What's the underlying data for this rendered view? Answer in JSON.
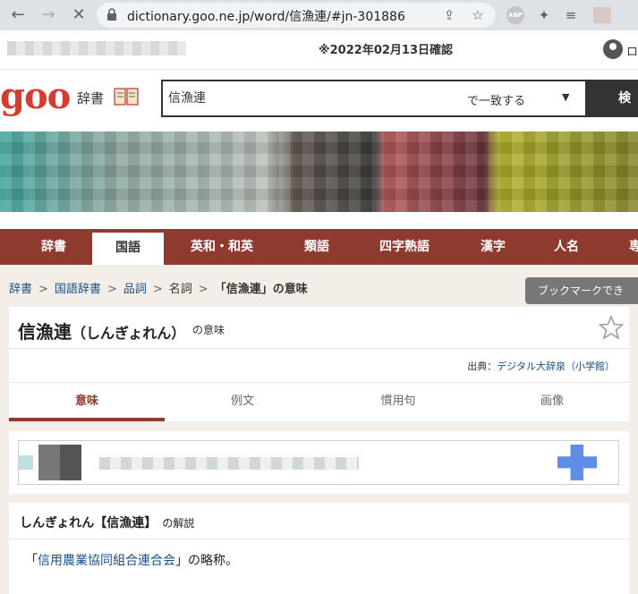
{
  "browser": {
    "url": "dictionary.goo.ne.jp/word/信漁連/#jn-301886"
  },
  "infobar": {
    "checked_date": "※2022年02月13日確認",
    "login_text": "ロ"
  },
  "header": {
    "logo": "goo",
    "dict_label": "辞書",
    "search_value": "信漁連",
    "match_mode": "で一致する",
    "search_button": "検索"
  },
  "nav": {
    "items": [
      {
        "label": "辞書",
        "active": false
      },
      {
        "label": "国語",
        "active": true
      },
      {
        "label": "英和・和英",
        "active": false
      },
      {
        "label": "類語",
        "active": false
      },
      {
        "label": "四字熟語",
        "active": false
      },
      {
        "label": "漢字",
        "active": false
      },
      {
        "label": "人名",
        "active": false
      },
      {
        "label": "専",
        "active": false
      }
    ]
  },
  "breadcrumb": {
    "items": [
      "辞書",
      "国語辞書",
      "品詞",
      "名詞"
    ],
    "current": "「信漁連」の意味"
  },
  "tooltip": "ブックマークでき",
  "entry": {
    "headword": "信漁連",
    "reading": "（しんぎょれん）",
    "suffix": "の意味",
    "source_label": "出典：",
    "source_name": "デジタル大辞泉（小学館）"
  },
  "tabs": [
    "意味",
    "例文",
    "慣用句",
    "画像"
  ],
  "explanation": {
    "title": "しんぎょれん【信漁連】",
    "title_suffix": "の解説",
    "body_open": "「",
    "body_link": "信用農業協同組合連合会",
    "body_close": "」の略称。"
  },
  "colors": {
    "brand_red": "#d53d32",
    "nav_bg": "#8e3a2f",
    "link_blue": "#1a4f8c"
  }
}
